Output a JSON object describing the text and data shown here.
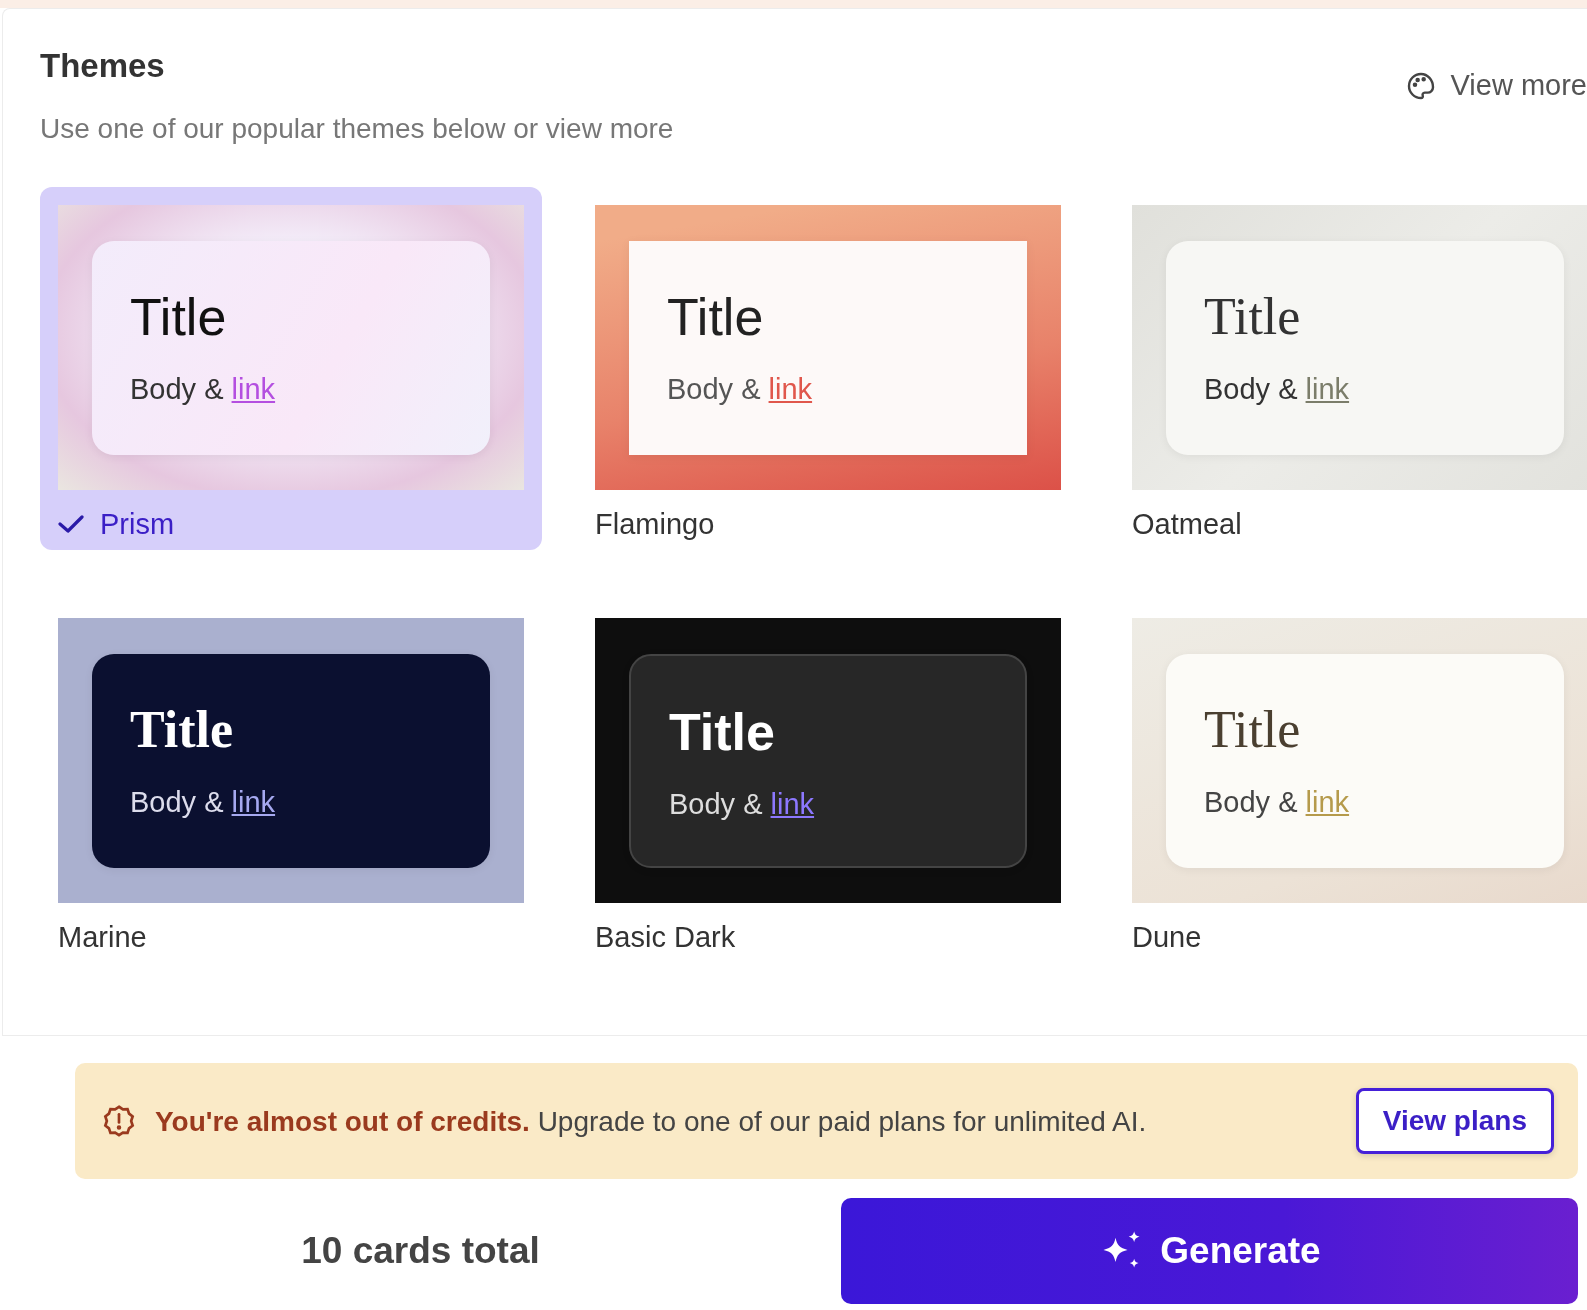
{
  "header": {
    "title": "Themes",
    "subtitle": "Use one of our popular themes below or view more",
    "view_more": "View more"
  },
  "themes": [
    {
      "name": "Prism",
      "kind": "prism",
      "selected": true,
      "title": "Title",
      "body": "Body &",
      "link": "link"
    },
    {
      "name": "Flamingo",
      "kind": "flamingo",
      "selected": false,
      "title": "Title",
      "body": "Body &",
      "link": "link"
    },
    {
      "name": "Oatmeal",
      "kind": "oatmeal",
      "selected": false,
      "title": "Title",
      "body": "Body &",
      "link": "link"
    },
    {
      "name": "Marine",
      "kind": "marine",
      "selected": false,
      "title": "Title",
      "body": "Body &",
      "link": "link"
    },
    {
      "name": "Basic Dark",
      "kind": "basicdark",
      "selected": false,
      "title": "Title",
      "body": "Body &",
      "link": "link"
    },
    {
      "name": "Dune",
      "kind": "dune",
      "selected": false,
      "title": "Title",
      "body": "Body &",
      "link": "link"
    }
  ],
  "banner": {
    "message": "**You're almost out of credits.** Upgrade to one of our paid plans for unlimited AI.",
    "button": "View plans"
  },
  "footer": {
    "total": "10 cards total",
    "generate": "Generate"
  }
}
